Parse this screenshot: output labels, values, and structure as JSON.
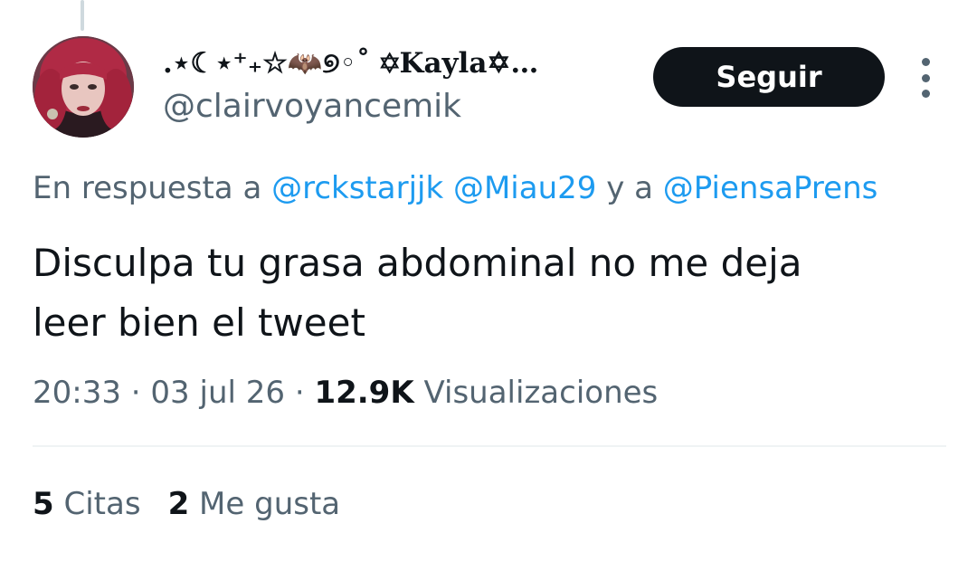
{
  "author": {
    "display_name": ".⋆☾⋆⁺₊☆🦇୭◦˚ ✡Kayla✡…",
    "handle": "@clairvoyancemik",
    "avatar_icon": "profile-photo-red-hair"
  },
  "follow_button": {
    "label": "Seguir"
  },
  "more_icon": "more-options-icon",
  "reply_to": {
    "prefix": "En respuesta a ",
    "user1": "@rckstarjjk",
    "user2": "@Miau29",
    "connector": " y a ",
    "user3": "@PiensaPrens"
  },
  "tweet": {
    "text": "Disculpa tu grasa abdominal no me deja\nleer bien el tweet",
    "time": "20:33",
    "sep1": " · ",
    "date": "03 jul 26",
    "sep2": " · ",
    "views_count": "12.9K",
    "views_label": " Visualizaciones"
  },
  "stats": {
    "quotes_count": "5",
    "quotes_label": "Citas",
    "likes_count": "2",
    "likes_label": "Me gusta"
  },
  "colors": {
    "link": "#1d9bf0",
    "secondary_text": "#536471",
    "primary_text": "#0f1419",
    "button_bg": "#0f1419",
    "divider": "#eff3f4"
  }
}
